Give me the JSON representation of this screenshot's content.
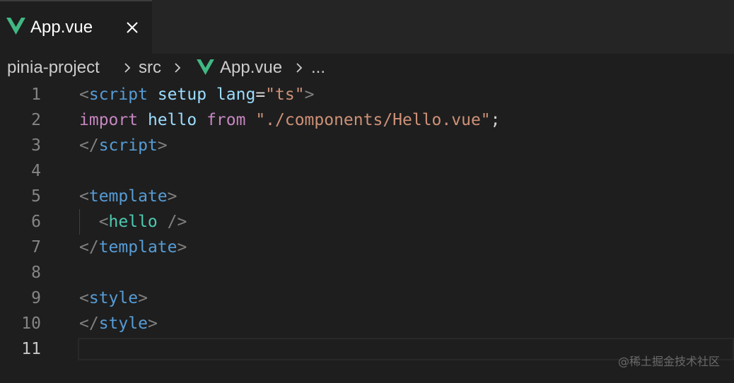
{
  "tab": {
    "label": "App.vue",
    "close_icon": "close-icon",
    "file_icon": "vue-icon"
  },
  "breadcrumb": {
    "items": [
      "pinia-project",
      "src",
      "App.vue",
      "..."
    ],
    "separator_icon": "chevron-right-icon"
  },
  "editor": {
    "line_numbers": [
      "1",
      "2",
      "3",
      "4",
      "5",
      "6",
      "7",
      "8",
      "9",
      "10",
      "11"
    ],
    "active_line": "11",
    "lines": [
      [
        {
          "t": "<",
          "c": "punc"
        },
        {
          "t": "script",
          "c": "tag"
        },
        {
          "t": " ",
          "c": "plain"
        },
        {
          "t": "setup",
          "c": "attr"
        },
        {
          "t": " ",
          "c": "plain"
        },
        {
          "t": "lang",
          "c": "attr"
        },
        {
          "t": "=",
          "c": "plain"
        },
        {
          "t": "\"ts\"",
          "c": "str"
        },
        {
          "t": ">",
          "c": "punc"
        }
      ],
      [
        {
          "t": "import",
          "c": "kw"
        },
        {
          "t": " ",
          "c": "plain"
        },
        {
          "t": "hello",
          "c": "id"
        },
        {
          "t": " ",
          "c": "plain"
        },
        {
          "t": "from",
          "c": "kw"
        },
        {
          "t": " ",
          "c": "plain"
        },
        {
          "t": "\"./components/Hello.vue\"",
          "c": "str"
        },
        {
          "t": ";",
          "c": "plain"
        }
      ],
      [
        {
          "t": "</",
          "c": "punc"
        },
        {
          "t": "script",
          "c": "tag"
        },
        {
          "t": ">",
          "c": "punc"
        }
      ],
      [],
      [
        {
          "t": "<",
          "c": "punc"
        },
        {
          "t": "template",
          "c": "tag"
        },
        {
          "t": ">",
          "c": "punc"
        }
      ],
      [
        {
          "t": "  <",
          "c": "punc"
        },
        {
          "t": "hello",
          "c": "comp"
        },
        {
          "t": " />",
          "c": "punc"
        }
      ],
      [
        {
          "t": "</",
          "c": "punc"
        },
        {
          "t": "template",
          "c": "tag"
        },
        {
          "t": ">",
          "c": "punc"
        }
      ],
      [],
      [
        {
          "t": "<",
          "c": "punc"
        },
        {
          "t": "style",
          "c": "tag"
        },
        {
          "t": ">",
          "c": "punc"
        }
      ],
      [
        {
          "t": "</",
          "c": "punc"
        },
        {
          "t": "style",
          "c": "tag"
        },
        {
          "t": ">",
          "c": "punc"
        }
      ],
      []
    ]
  },
  "watermark": "@稀土掘金技术社区",
  "colors": {
    "background": "#1e1e1e",
    "tag": "#569cd6",
    "attribute": "#9cdcfe",
    "string": "#ce9178",
    "keyword": "#c586c0",
    "component": "#4ec9b0",
    "vue_green": "#41b883"
  }
}
